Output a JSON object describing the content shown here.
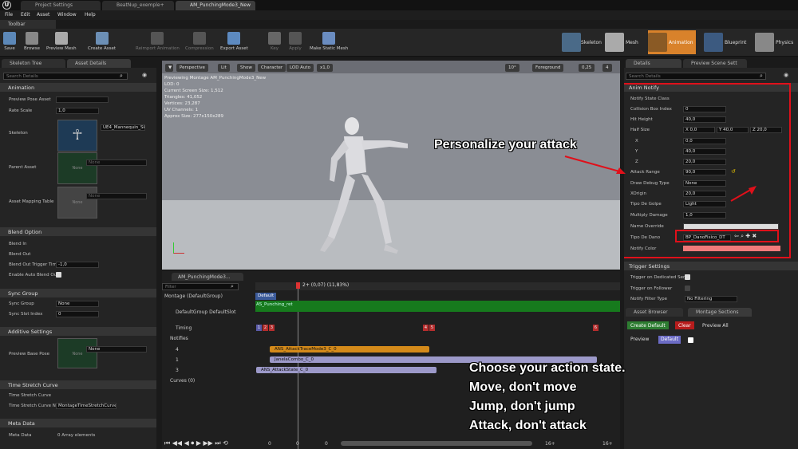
{
  "tabs": [
    "Project Settings",
    "BeatNup_exemple+",
    "AM_PunchingMode3_New"
  ],
  "menu": [
    "File",
    "Edit",
    "Asset",
    "Window",
    "Help"
  ],
  "toolbar_tab": "Toolbar",
  "toolbar": [
    "Save",
    "Browse",
    "Preview Mesh",
    "Create Asset",
    "Reimport Animation",
    "Compression",
    "Export Asset",
    "Key",
    "Apply",
    "Make Static Mesh"
  ],
  "modes": [
    "Skeleton",
    "Mesh",
    "Animation",
    "Blueprint",
    "Physics"
  ],
  "left": {
    "tabs": [
      "Skeleton Tree",
      "Asset Details"
    ],
    "search": "Search Details",
    "sections": {
      "animation": "Animation",
      "blend": "Blend Option",
      "sync": "Sync Group",
      "additive": "Additive Settings",
      "timestretch": "Time Stretch Curve",
      "meta": "Meta Data"
    },
    "labels": {
      "preview_pose": "Preview Pose Asset",
      "rate_scale": "Rate Scale",
      "skeleton": "Skeleton",
      "parent_asset": "Parent Asset",
      "asset_mapping": "Asset Mapping Table",
      "blend_in": "Blend In",
      "blend_out": "Blend Out",
      "blend_out_trigger": "Blend Out Trigger Tim",
      "enable_auto_blend": "Enable Auto Blend Ou",
      "sync_group": "Sync Group",
      "sync_slot": "Sync Slot Index",
      "preview_base": "Preview Base Pose",
      "ts_curve": "Time Stretch Curve",
      "ts_curve_n": "Time Stretch Curve N",
      "meta_data": "Meta Data"
    },
    "values": {
      "rate_scale": "1,0",
      "skeleton": "UE4_Mannequin_Skeleton",
      "none": "None",
      "blend_out_trigger": "-1,0",
      "sync_group": "None",
      "sync_slot": "0",
      "ts_curve_n": "MontageTimeStretchCurve",
      "meta_data": "0 Array elements"
    }
  },
  "viewport": {
    "buttons": [
      "Perspective",
      "Lit",
      "Show",
      "Character",
      "LOD Auto",
      "x1,0"
    ],
    "right_buttons": [
      "10°",
      "Foreground",
      "0,25",
      "4"
    ],
    "info": [
      "Previewing Montage AM_PunchingMode3_New",
      "LOD: 0",
      "Current Screen Size: 1,512",
      "Triangles: 41,052",
      "Vertices: 23,287",
      "UV Channels: 1",
      "Approx Size: 277x150x289"
    ]
  },
  "timeline": {
    "tab": "AM_PunchingMode3...",
    "filter": "Filter",
    "playhead": "2+ (0,07) (11,83%)",
    "rows": [
      "Montage (DefaultGroup)",
      "DefaultGroup DefaultSlot",
      "Timing",
      "Notifies",
      "4",
      "1",
      "3",
      "Curves (0)"
    ],
    "default_label": "Default",
    "slot_segment": "AS_Punching_ret",
    "notifies": [
      "ANS_AttackTraceMode3_C_0",
      "JanelaCombo_C_0",
      "ANS_AttackState_C_0"
    ],
    "markers": [
      "1",
      "2",
      "3",
      "4",
      "5",
      "6"
    ],
    "footer": [
      "0",
      "0",
      "0",
      "16+",
      "16+"
    ]
  },
  "right": {
    "tabs": [
      "Details",
      "Preview Scene Sett"
    ],
    "search": "Search Details",
    "anim_notify": "Anim Notify",
    "labels": [
      "Notify State Class",
      "Collision Box Index",
      "Hit Height",
      "Half Size",
      "X",
      "Y",
      "Z",
      "Attack Range",
      "Draw Debug Type",
      "XOrigin",
      "Tipo De Golpe",
      "Multiply Damage",
      "Name Override",
      "Tipo De Dano",
      "Notify Color"
    ],
    "values": {
      "collision": "0",
      "hit_height": "40,0",
      "half_x": "X 0,0",
      "half_y": "Y 40,0",
      "half_z": "Z 20,0",
      "x": "0,0",
      "y": "40,0",
      "z": "20,0",
      "attack_range": "90,0",
      "draw_debug": "None",
      "xorigin": "20,0",
      "tipo_golpe": "Light",
      "multiply": "1,0",
      "tipo_dano": "BP_DanoFisico_DT"
    },
    "trigger": {
      "title": "Trigger Settings",
      "labels": [
        "Trigger on Dedicated Ser",
        "Trigger on Follower",
        "Notify Filter Type"
      ],
      "filter": "No Filtering"
    },
    "bottom_tabs": [
      "Asset Browser",
      "Montage Sections"
    ],
    "buttons": {
      "create": "Create Default",
      "clear": "Clear",
      "preview_all": "Preview All",
      "preview": "Preview",
      "default": "Default"
    }
  },
  "captions": {
    "c1": "Personalize your attack",
    "c2": [
      "Choose your action state.",
      "Move, don't move",
      "Jump, don't jump",
      "Attack, don't attack"
    ]
  }
}
